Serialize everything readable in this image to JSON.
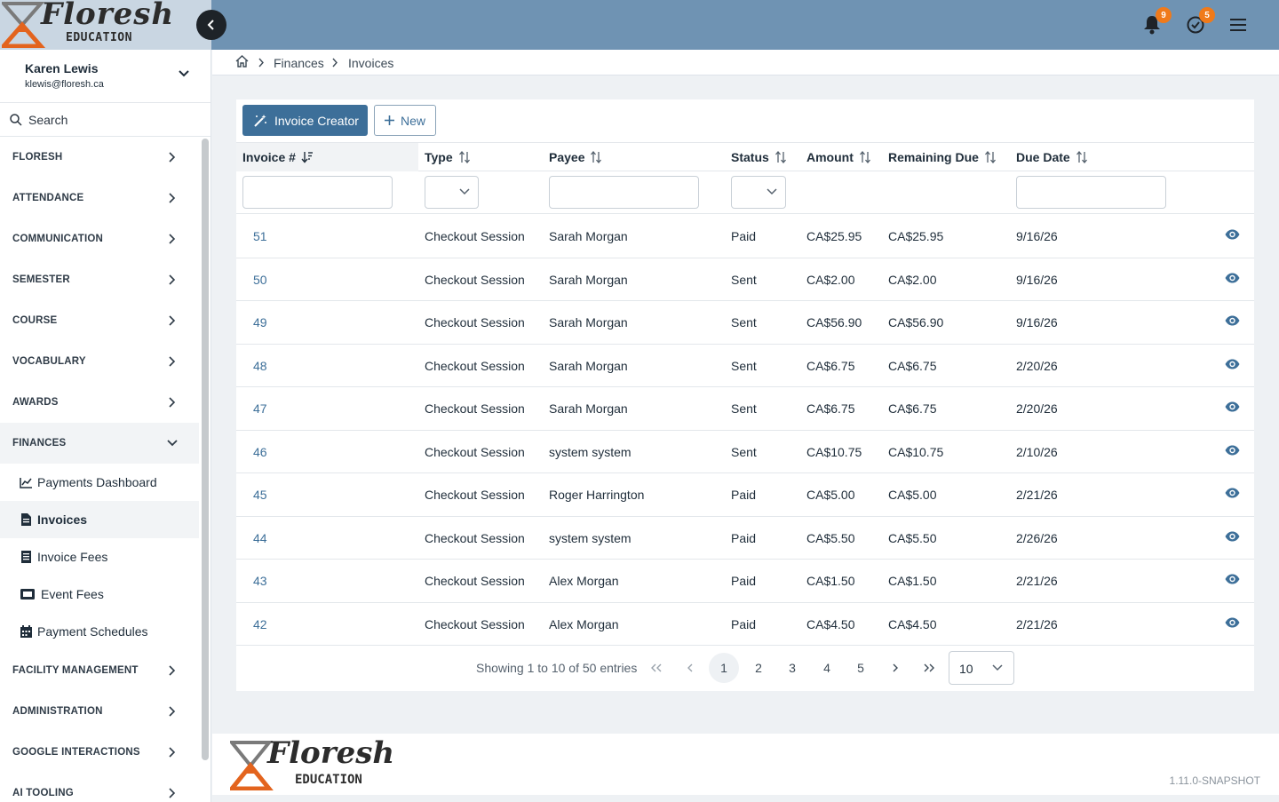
{
  "brand": {
    "script": "Floresh",
    "sub": "EDUCATION"
  },
  "header": {
    "notifications_count": "9",
    "tasks_count": "5"
  },
  "user": {
    "name": "Karen Lewis",
    "email": "klewis@floresh.ca"
  },
  "search": {
    "label": "Search"
  },
  "nav": {
    "items": [
      "FLORESH",
      "ATTENDANCE",
      "COMMUNICATION",
      "SEMESTER",
      "COURSE",
      "VOCABULARY",
      "AWARDS"
    ],
    "finances": "FINANCES",
    "finances_sub": [
      "Payments Dashboard",
      "Invoices",
      "Invoice Fees",
      "Event Fees",
      "Payment Schedules"
    ],
    "after": [
      "FACILITY MANAGEMENT",
      "ADMINISTRATION",
      "GOOGLE INTERACTIONS",
      "AI TOOLING"
    ]
  },
  "breadcrumb": {
    "level1": "Finances",
    "level2": "Invoices"
  },
  "toolbar": {
    "invoice_creator": "Invoice Creator",
    "new": "New"
  },
  "table": {
    "columns": [
      "Invoice #",
      "Type",
      "Payee",
      "Status",
      "Amount",
      "Remaining Due",
      "Due Date"
    ],
    "rows": [
      {
        "id": "51",
        "type": "Checkout Session",
        "payee": "Sarah Morgan",
        "status": "Paid",
        "amount": "CA$25.95",
        "remaining": "CA$25.95",
        "due": "9/16/26"
      },
      {
        "id": "50",
        "type": "Checkout Session",
        "payee": "Sarah Morgan",
        "status": "Sent",
        "amount": "CA$2.00",
        "remaining": "CA$2.00",
        "due": "9/16/26"
      },
      {
        "id": "49",
        "type": "Checkout Session",
        "payee": "Sarah Morgan",
        "status": "Sent",
        "amount": "CA$56.90",
        "remaining": "CA$56.90",
        "due": "9/16/26"
      },
      {
        "id": "48",
        "type": "Checkout Session",
        "payee": "Sarah Morgan",
        "status": "Sent",
        "amount": "CA$6.75",
        "remaining": "CA$6.75",
        "due": "2/20/26"
      },
      {
        "id": "47",
        "type": "Checkout Session",
        "payee": "Sarah Morgan",
        "status": "Sent",
        "amount": "CA$6.75",
        "remaining": "CA$6.75",
        "due": "2/20/26"
      },
      {
        "id": "46",
        "type": "Checkout Session",
        "payee": "system system",
        "status": "Sent",
        "amount": "CA$10.75",
        "remaining": "CA$10.75",
        "due": "2/10/26"
      },
      {
        "id": "45",
        "type": "Checkout Session",
        "payee": "Roger Harrington",
        "status": "Paid",
        "amount": "CA$5.00",
        "remaining": "CA$5.00",
        "due": "2/21/26"
      },
      {
        "id": "44",
        "type": "Checkout Session",
        "payee": "system system",
        "status": "Paid",
        "amount": "CA$5.50",
        "remaining": "CA$5.50",
        "due": "2/26/26"
      },
      {
        "id": "43",
        "type": "Checkout Session",
        "payee": "Alex Morgan",
        "status": "Paid",
        "amount": "CA$1.50",
        "remaining": "CA$1.50",
        "due": "2/21/26"
      },
      {
        "id": "42",
        "type": "Checkout Session",
        "payee": "Alex Morgan",
        "status": "Paid",
        "amount": "CA$4.50",
        "remaining": "CA$4.50",
        "due": "2/21/26"
      }
    ]
  },
  "pager": {
    "info": "Showing 1 to 10 of 50 entries",
    "pages": [
      "1",
      "2",
      "3",
      "4",
      "5"
    ],
    "current": "1",
    "page_size": "10"
  },
  "footer": {
    "version": "1.11.0-SNAPSHOT"
  },
  "colors": {
    "header": "#6f93b3",
    "primary": "#3d6f99",
    "badge": "#f07a1a",
    "link": "#3d6f99"
  }
}
